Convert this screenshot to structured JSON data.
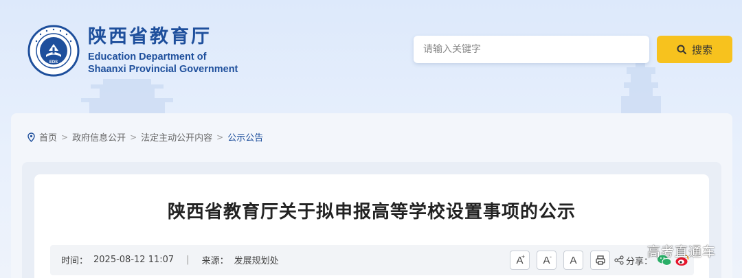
{
  "brand": {
    "name_cn": "陕西省教育厅",
    "name_en_line1": "Education Department of",
    "name_en_line2": "Shaanxi Provincial Government",
    "emblem_text": "EDS"
  },
  "search": {
    "placeholder": "请输入关键字",
    "value": "",
    "button_label": "搜索"
  },
  "breadcrumb": {
    "items": [
      "首页",
      "政府信息公开",
      "法定主动公开内容",
      "公示公告"
    ],
    "separator": ">"
  },
  "article": {
    "title": "陕西省教育厅关于拟申报高等学校设置事项的公示",
    "time_label": "时间：",
    "time_value": "2025-08-12 11:07",
    "divider": "|",
    "source_label": "来源：",
    "source_value": "发展规划处"
  },
  "tools": {
    "font_increase": "A",
    "font_increase_sup": "+",
    "font_decrease": "A",
    "font_decrease_sup": "-",
    "font_reset": "A",
    "share_label": "分享："
  },
  "watermark": "高考直通车",
  "colors": {
    "brand_blue": "#1e4f9c",
    "accent_yellow": "#f7c21e",
    "wechat_green": "#2aae67",
    "weibo_red": "#e6162d"
  }
}
